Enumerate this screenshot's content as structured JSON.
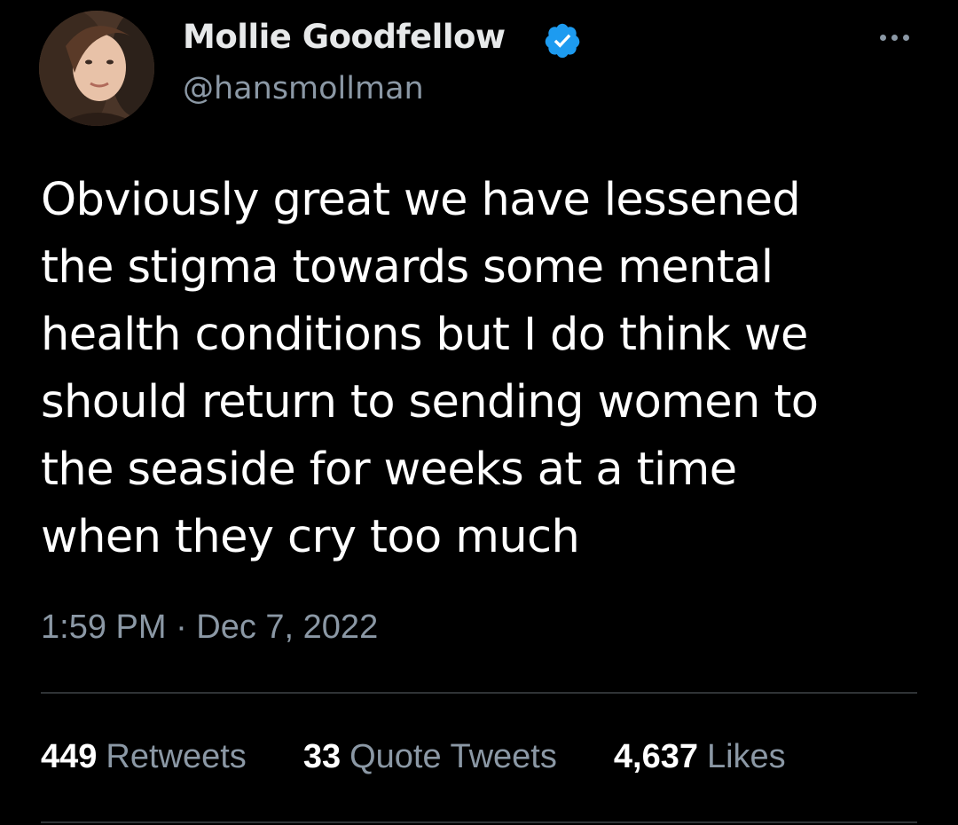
{
  "author": {
    "display_name": "Mollie Goodfellow",
    "handle": "@hansmollman",
    "verified": true,
    "avatar_icon": "profile-photo"
  },
  "menu": {
    "icon": "more-horizontal-icon"
  },
  "tweet": {
    "text_lines": [
      "Obviously great we have lessened",
      "the stigma towards some mental",
      "health conditions but I do think we",
      "should return to sending women to",
      "the seaside for weeks at a time",
      "when they cry too much"
    ],
    "timestamp": "1:59 PM · Dec 7, 2022"
  },
  "stats": {
    "retweets": {
      "count": "449",
      "label": "Retweets"
    },
    "quotes": {
      "count": "33",
      "label": "Quote Tweets"
    },
    "likes": {
      "count": "4,637",
      "label": "Likes"
    }
  },
  "colors": {
    "background": "#000000",
    "primary_text": "#e7e9ea",
    "secondary_text": "#8b98a5",
    "verified_blue": "#1d9bf0",
    "divider": "#2f3336"
  }
}
